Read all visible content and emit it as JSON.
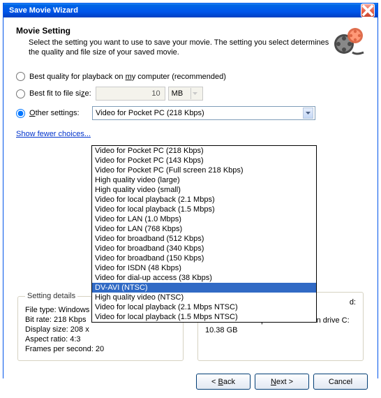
{
  "window": {
    "title": "Save Movie Wizard"
  },
  "header": {
    "title": "Movie Setting",
    "desc": "Select the setting you want to use to save your movie. The setting you select determines the quality and file size of your saved movie."
  },
  "options": {
    "best_quality_pre": "Best quality for playback on ",
    "best_quality_u": "m",
    "best_quality_post": "y computer (recommended)",
    "best_fit_pre": "Best fit to file si",
    "best_fit_u": "z",
    "best_fit_post": "e:",
    "size_value": "10",
    "size_unit": "MB",
    "other_settings_u": "O",
    "other_settings_post": "ther settings:",
    "combo_selected": "Video for Pocket PC (218 Kbps)",
    "show_fewer": "Show fewer choices..."
  },
  "dropdown": [
    "Video for Pocket PC (218 Kbps)",
    "Video for Pocket PC (143 Kbps)",
    "Video for Pocket PC (Full screen 218 Kbps)",
    "High quality video (large)",
    "High quality video (small)",
    "Video for local playback (2.1 Mbps)",
    "Video for local playback (1.5 Mbps)",
    "Video for LAN (1.0 Mbps)",
    "Video for LAN (768 Kbps)",
    "Video for broadband (512 Kbps)",
    "Video for broadband (340 Kbps)",
    "Video for broadband (150 Kbps)",
    "Video for ISDN (48 Kbps)",
    "Video for dial-up access (38 Kbps)",
    "DV-AVI (NTSC)",
    "High quality video (NTSC)",
    "Video for local playback (2.1 Mbps NTSC)",
    "Video for local playback (1.5 Mbps NTSC)"
  ],
  "dropdown_highlight_index": 14,
  "details": {
    "legend": "Setting details",
    "file_type": "File type: Windows",
    "bit_rate": "Bit rate: 218 Kbps",
    "display_size": "Display size: 208 x",
    "aspect_ratio": "Aspect ratio: 4:3",
    "fps": "Frames per second: 20"
  },
  "size_info": {
    "legend": "",
    "required_lbl": "d:",
    "space_lbl": "Estimated disk space available on drive C:",
    "space_val": "10.38 GB"
  },
  "buttons": {
    "back_pre": "< ",
    "back_u": "B",
    "back_post": "ack",
    "next_u": "N",
    "next_post": "ext >",
    "cancel": "Cancel"
  }
}
